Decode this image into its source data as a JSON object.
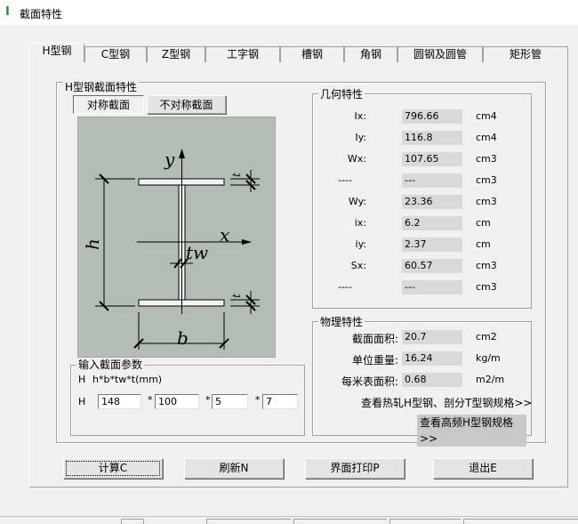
{
  "window": {
    "title": "截面特性",
    "icon": "i-beam-icon"
  },
  "tabs": [
    {
      "label": "H型钢",
      "active": true
    },
    {
      "label": "C型钢"
    },
    {
      "label": "Z型钢"
    },
    {
      "label": "工字钢"
    },
    {
      "label": "槽钢"
    },
    {
      "label": "角钢"
    },
    {
      "label": "圆钢及圆管"
    },
    {
      "label": "矩形管"
    }
  ],
  "section": {
    "group_title": "H型钢截面特性",
    "sym_button": "对称截面",
    "asym_button": "不对称截面",
    "diagram": {
      "y": "y",
      "x": "x",
      "h": "h",
      "b": "b",
      "tw": "tw",
      "t_top": "t",
      "t_bottom": "t"
    }
  },
  "inputs": {
    "group_title": "输入截面参数",
    "row_label": "H",
    "formula": "h*b*tw*t(mm)",
    "h": "148",
    "b": "100",
    "tw": "5",
    "t": "7",
    "sep": "*"
  },
  "geometry": {
    "group_title": "几何特性",
    "rows": [
      {
        "label": "Ix:",
        "value": "796.66",
        "unit": "cm4"
      },
      {
        "label": "Iy:",
        "value": "116.8",
        "unit": "cm4"
      },
      {
        "label": "Wx:",
        "value": "107.65",
        "unit": "cm3"
      },
      {
        "label": "----",
        "value": "---",
        "unit": "cm3"
      },
      {
        "label": "Wy:",
        "value": "23.36",
        "unit": "cm3"
      },
      {
        "label": "ix:",
        "value": "6.2",
        "unit": "cm"
      },
      {
        "label": "iy:",
        "value": "2.37",
        "unit": "cm"
      },
      {
        "label": "Sx:",
        "value": "60.57",
        "unit": "cm3"
      },
      {
        "label": "----",
        "value": "---",
        "unit": "cm3"
      }
    ]
  },
  "physical": {
    "group_title": "物理特性",
    "rows": [
      {
        "label": "截面面积:",
        "value": "20.7",
        "unit": "cm2"
      },
      {
        "label": "单位重量:",
        "value": "16.24",
        "unit": "kg/m"
      },
      {
        "label": "每米表面积:",
        "value": "0.68",
        "unit": "m2/m"
      }
    ],
    "link_hot": "查看热轧H型钢、剖分T型钢规格>>",
    "link_hf": "查看高频H型钢规格>>"
  },
  "buttons": {
    "calc": "计算C",
    "refresh": "刷新N",
    "print": "界面打印P",
    "exit": "退出E"
  }
}
